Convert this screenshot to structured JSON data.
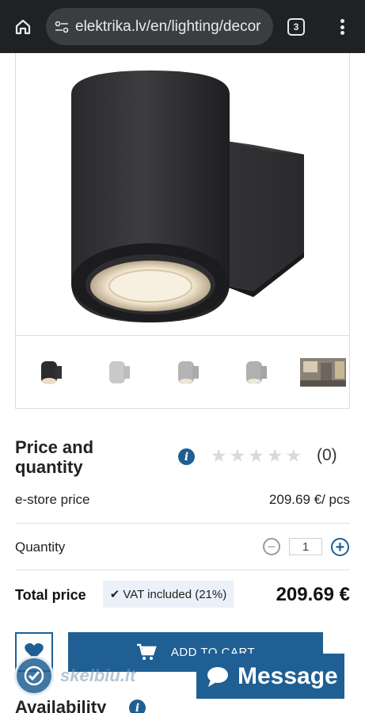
{
  "browser": {
    "url": "elektrika.lv/en/lighting/decor",
    "tab_count": "3"
  },
  "product": {
    "thumbnail_count": 5
  },
  "price_section": {
    "title": "Price and quantity",
    "rating_count": "(0)",
    "rating_stars": 0,
    "estore_label": "e-store price",
    "estore_price": "209.69 €/ pcs",
    "quantity_label": "Quantity",
    "quantity_value": "1",
    "total_label": "Total price",
    "vat_text": "VAT included (21%)",
    "total_price": "209.69 €"
  },
  "actions": {
    "add_to_cart": "ADD TO CART",
    "message": "Message"
  },
  "watermark": {
    "text": "skelbiu.lt"
  },
  "availability": {
    "title": "Availability"
  },
  "colors": {
    "accent": "#1f5f93",
    "browser_bar": "#202124"
  }
}
